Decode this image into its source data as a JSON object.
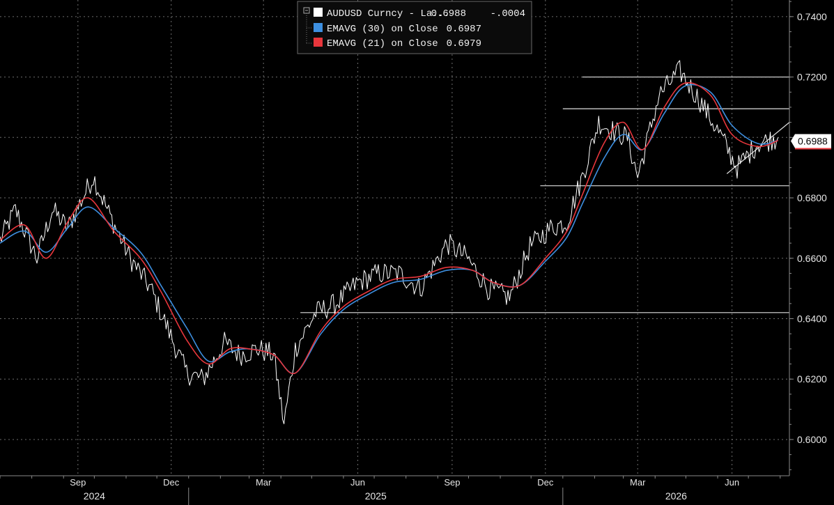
{
  "chart_data": {
    "type": "line",
    "title": "",
    "xlabel": "",
    "ylabel": "",
    "ylim": [
      0.588,
      0.7455
    ],
    "y_ticks": [
      "0.6000",
      "0.6200",
      "0.6400",
      "0.6600",
      "0.6800",
      "0.7000",
      "0.7200",
      "0.7400"
    ],
    "x_months": [
      "Sep",
      "Dec",
      "Mar",
      "Jun",
      "Sep",
      "Dec",
      "Mar",
      "Jun"
    ],
    "x_years": [
      "2024",
      "2025",
      "2026"
    ],
    "legend": [
      {
        "label": "AUDUSD Curncy - La...",
        "value": "0.6988",
        "change": "-.0004",
        "color": "#ffffff"
      },
      {
        "label": "EMAVG (30)  on Close",
        "value": "0.6987",
        "change": "",
        "color": "#3d8fe0"
      },
      {
        "label": "EMAVG (21)  on Close",
        "value": "0.6979",
        "change": "",
        "color": "#e8363c"
      }
    ],
    "last_price_label": "0.6988",
    "legend_placement": "top-center",
    "grid": true,
    "series": [
      {
        "name": "AUDUSD Curncy",
        "color": "#ffffff",
        "x": [
          "2024-07-01",
          "2024-07-16",
          "2024-08-06",
          "2024-08-21",
          "2024-09-05",
          "2024-09-30",
          "2024-10-15",
          "2024-11-05",
          "2024-11-25",
          "2024-12-10",
          "2024-12-30",
          "2025-01-15",
          "2025-02-05",
          "2025-02-20",
          "2025-03-10",
          "2025-03-25",
          "2025-04-04",
          "2025-04-15",
          "2025-05-05",
          "2025-05-25",
          "2025-06-15",
          "2025-07-05",
          "2025-07-25",
          "2025-08-15",
          "2025-09-10",
          "2025-09-30",
          "2025-10-20",
          "2025-11-10",
          "2025-11-30",
          "2025-12-20",
          "2026-01-05",
          "2026-01-20",
          "2026-02-05",
          "2026-02-20",
          "2026-03-05",
          "2026-03-15",
          "2026-04-05",
          "2026-04-25",
          "2026-05-15",
          "2026-06-05",
          "2026-06-20",
          "2026-07-10",
          "2026-07-30"
        ],
        "y": [
          0.666,
          0.676,
          0.66,
          0.676,
          0.67,
          0.687,
          0.675,
          0.66,
          0.65,
          0.638,
          0.622,
          0.62,
          0.632,
          0.628,
          0.63,
          0.628,
          0.605,
          0.63,
          0.642,
          0.645,
          0.652,
          0.655,
          0.655,
          0.65,
          0.665,
          0.66,
          0.65,
          0.647,
          0.664,
          0.67,
          0.672,
          0.687,
          0.705,
          0.702,
          0.7,
          0.687,
          0.714,
          0.722,
          0.712,
          0.7,
          0.69,
          0.698,
          0.7
        ]
      },
      {
        "name": "EMAVG (30) on Close",
        "color": "#3d8fe0",
        "x": [
          "2024-07-01",
          "2024-07-25",
          "2024-08-15",
          "2024-09-05",
          "2024-09-25",
          "2024-10-20",
          "2024-11-15",
          "2024-12-05",
          "2024-12-30",
          "2025-01-20",
          "2025-02-10",
          "2025-03-01",
          "2025-03-25",
          "2025-04-15",
          "2025-05-10",
          "2025-06-01",
          "2025-06-25",
          "2025-07-20",
          "2025-08-15",
          "2025-09-10",
          "2025-10-05",
          "2025-10-25",
          "2025-11-20",
          "2025-12-15",
          "2026-01-05",
          "2026-01-20",
          "2026-02-10",
          "2026-03-01",
          "2026-03-20",
          "2026-04-10",
          "2026-04-30",
          "2026-05-25",
          "2026-06-15",
          "2026-07-10",
          "2026-07-30"
        ],
        "y": [
          0.665,
          0.669,
          0.662,
          0.67,
          0.677,
          0.67,
          0.662,
          0.651,
          0.637,
          0.626,
          0.629,
          0.63,
          0.628,
          0.622,
          0.635,
          0.643,
          0.648,
          0.652,
          0.653,
          0.656,
          0.656,
          0.652,
          0.651,
          0.659,
          0.667,
          0.678,
          0.693,
          0.701,
          0.696,
          0.708,
          0.717,
          0.715,
          0.704,
          0.698,
          0.699
        ]
      },
      {
        "name": "EMAVG (21) on Close",
        "color": "#e8363c",
        "x": [
          "2024-07-01",
          "2024-07-25",
          "2024-08-15",
          "2024-09-05",
          "2024-09-25",
          "2024-10-20",
          "2024-11-15",
          "2024-12-05",
          "2024-12-30",
          "2025-01-20",
          "2025-02-10",
          "2025-03-01",
          "2025-03-25",
          "2025-04-15",
          "2025-05-10",
          "2025-06-01",
          "2025-06-25",
          "2025-07-20",
          "2025-08-15",
          "2025-09-10",
          "2025-10-05",
          "2025-10-25",
          "2025-11-20",
          "2025-12-15",
          "2026-01-05",
          "2026-01-20",
          "2026-02-10",
          "2026-03-01",
          "2026-03-20",
          "2026-04-10",
          "2026-04-30",
          "2026-05-25",
          "2026-06-15",
          "2026-07-10",
          "2026-07-30"
        ],
        "y": [
          0.666,
          0.671,
          0.66,
          0.672,
          0.68,
          0.669,
          0.66,
          0.649,
          0.633,
          0.625,
          0.63,
          0.63,
          0.628,
          0.622,
          0.636,
          0.644,
          0.649,
          0.653,
          0.654,
          0.657,
          0.656,
          0.652,
          0.651,
          0.66,
          0.669,
          0.681,
          0.698,
          0.705,
          0.696,
          0.71,
          0.718,
          0.714,
          0.701,
          0.697,
          0.699
        ]
      }
    ],
    "annotations": [
      {
        "type": "hline",
        "y": 0.642,
        "x0": "2025-04-20",
        "x1": "2026-08-10"
      },
      {
        "type": "hline",
        "y": 0.684,
        "x0": "2025-12-10",
        "x1": "2026-08-10"
      },
      {
        "type": "hline",
        "y": 0.7095,
        "x0": "2026-01-01",
        "x1": "2026-08-10"
      },
      {
        "type": "hline",
        "y": 0.72,
        "x0": "2026-01-20",
        "x1": "2026-08-10"
      },
      {
        "type": "trendline",
        "x0": "2026-06-10",
        "y0": 0.688,
        "x1": "2026-08-10",
        "y1": 0.705
      }
    ]
  }
}
